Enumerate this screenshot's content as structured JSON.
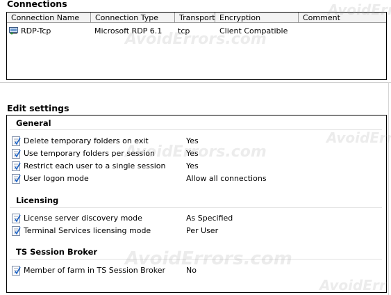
{
  "connections": {
    "title": "Connections",
    "columns": [
      "Connection Name",
      "Connection Type",
      "Transport",
      "Encryption",
      "Comment"
    ],
    "rows": [
      {
        "name": "RDP-Tcp",
        "type": "Microsoft RDP 6.1",
        "transport": "tcp",
        "encryption": "Client Compatible",
        "comment": ""
      }
    ]
  },
  "edit_settings": {
    "title": "Edit settings",
    "general": {
      "title": "General",
      "items": [
        {
          "label": "Delete temporary folders on exit",
          "value": "Yes"
        },
        {
          "label": "Use temporary folders per session",
          "value": "Yes"
        },
        {
          "label": "Restrict each user to a single session",
          "value": "Yes"
        },
        {
          "label": "User logon mode",
          "value": "Allow all connections"
        }
      ]
    },
    "licensing": {
      "title": "Licensing",
      "items": [
        {
          "label": "License server discovery mode",
          "value": "As Specified"
        },
        {
          "label": "Terminal Services licensing mode",
          "value": "Per User"
        }
      ]
    },
    "broker": {
      "title": "TS Session Broker",
      "items": [
        {
          "label": "Member of farm in TS Session Broker",
          "value": "No"
        }
      ]
    }
  },
  "watermark": "AvoidErrors.com",
  "watermark_short": "AvoidErr"
}
